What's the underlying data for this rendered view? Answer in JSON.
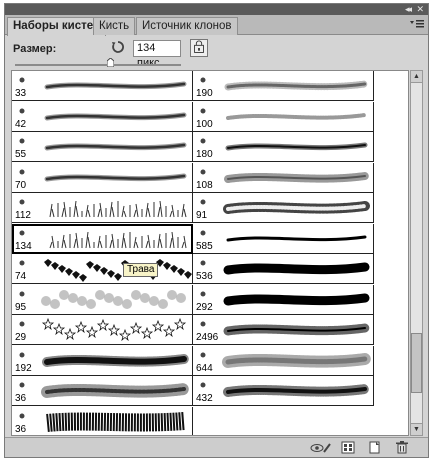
{
  "window": {
    "collapse_glyph": "◂◂",
    "close_glyph": "✕"
  },
  "tabs": [
    {
      "label": "Наборы кистей",
      "active": true
    },
    {
      "label": "Кисть",
      "active": false
    },
    {
      "label": "Источник клонов",
      "active": false
    }
  ],
  "panel_menu_icon": "panel-menu-icon",
  "size": {
    "label": "Размер:",
    "value": "134 пикс.",
    "slider_fraction": 0.57
  },
  "tooltip": "Трава",
  "brushes": [
    {
      "num": "33",
      "kind": "soft"
    },
    {
      "num": "190",
      "kind": "scatter"
    },
    {
      "num": "42",
      "kind": "soft"
    },
    {
      "num": "100",
      "kind": "scatter-thin"
    },
    {
      "num": "55",
      "kind": "soft"
    },
    {
      "num": "180",
      "kind": "dark"
    },
    {
      "num": "70",
      "kind": "soft"
    },
    {
      "num": "108",
      "kind": "textured"
    },
    {
      "num": "112",
      "kind": "grass"
    },
    {
      "num": "91",
      "kind": "chain"
    },
    {
      "num": "134",
      "kind": "grass"
    },
    {
      "num": "585",
      "kind": "hard"
    },
    {
      "num": "74",
      "kind": "leaves"
    },
    {
      "num": "536",
      "kind": "heavy"
    },
    {
      "num": "95",
      "kind": "blobs"
    },
    {
      "num": "292",
      "kind": "heavy"
    },
    {
      "num": "29",
      "kind": "stars"
    },
    {
      "num": "2496",
      "kind": "lines"
    },
    {
      "num": "192",
      "kind": "fuzzy"
    },
    {
      "num": "644",
      "kind": "grey-textured"
    },
    {
      "num": "36",
      "kind": "speckle"
    },
    {
      "num": "432",
      "kind": "ticked"
    },
    {
      "num": "36",
      "kind": "dense"
    }
  ],
  "selected_index": 10,
  "bottom_icons": [
    "eye-brush-icon",
    "grid-panel-icon",
    "new-preset-icon",
    "trash-icon"
  ]
}
